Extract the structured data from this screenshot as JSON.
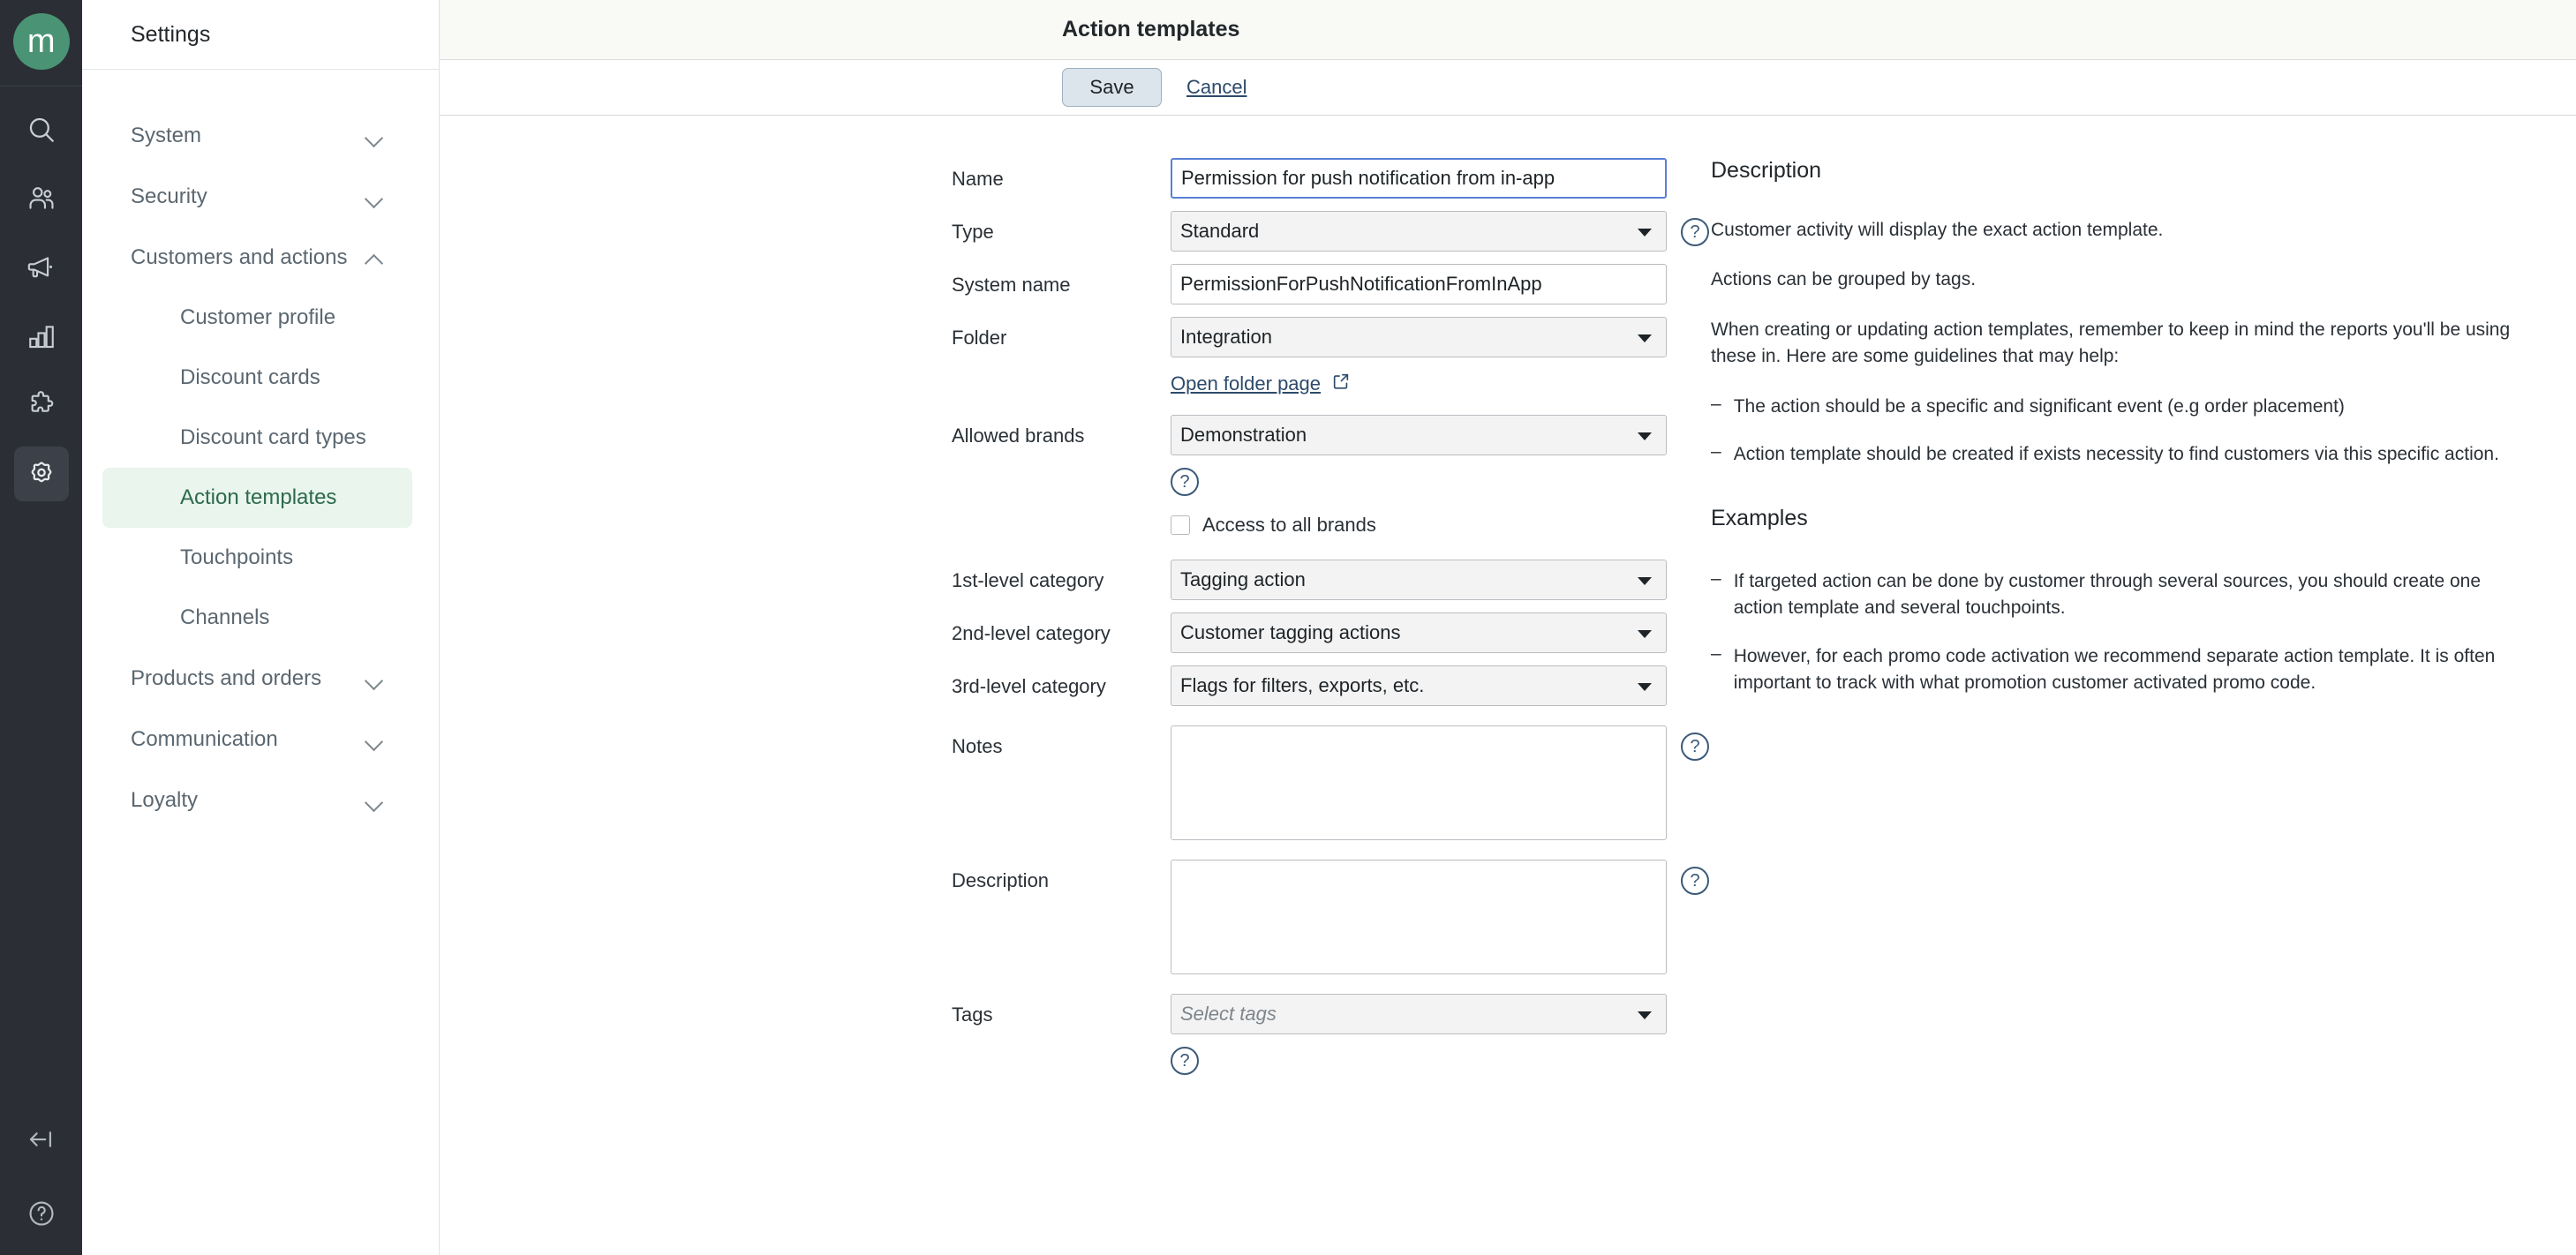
{
  "rail": {
    "logo_text": "m",
    "items": [
      {
        "name": "search-icon",
        "label": "Search",
        "active": false
      },
      {
        "name": "customers-icon",
        "label": "Customers",
        "active": false
      },
      {
        "name": "campaigns-megaphone-icon",
        "label": "Campaigns",
        "active": false
      },
      {
        "name": "analytics-bar-chart-icon",
        "label": "Analytics",
        "active": false
      },
      {
        "name": "integrations-puzzle-icon",
        "label": "Integrations",
        "active": false
      },
      {
        "name": "settings-gear-icon",
        "label": "Settings",
        "active": true
      }
    ],
    "bottom": [
      {
        "name": "collapse-sidebar-icon",
        "label": "Collapse"
      },
      {
        "name": "help-circle-icon",
        "label": "Help"
      }
    ]
  },
  "sidebar": {
    "title": "Settings",
    "groups": [
      {
        "label": "System",
        "expanded": false,
        "items": []
      },
      {
        "label": "Security",
        "expanded": false,
        "items": []
      },
      {
        "label": "Customers and actions",
        "expanded": true,
        "items": [
          {
            "label": "Customer profile",
            "active": false
          },
          {
            "label": "Discount cards",
            "active": false
          },
          {
            "label": "Discount card types",
            "active": false
          },
          {
            "label": "Action templates",
            "active": true
          },
          {
            "label": "Touchpoints",
            "active": false
          },
          {
            "label": "Channels",
            "active": false
          }
        ]
      },
      {
        "label": "Products and orders",
        "expanded": false,
        "items": []
      },
      {
        "label": "Communication",
        "expanded": false,
        "items": []
      },
      {
        "label": "Loyalty",
        "expanded": false,
        "items": []
      }
    ]
  },
  "page": {
    "title": "Action templates",
    "toolbar": {
      "save_label": "Save",
      "cancel_label": "Cancel"
    }
  },
  "form": {
    "name": {
      "label": "Name",
      "value": "Permission for push notification from in-app"
    },
    "type": {
      "label": "Type",
      "value": "Standard"
    },
    "system_name": {
      "label": "System name",
      "value": "PermissionForPushNotificationFromInApp"
    },
    "folder": {
      "label": "Folder",
      "value": "Integration"
    },
    "folder_link": {
      "label": "Open folder page"
    },
    "allowed_brands": {
      "label": "Allowed brands",
      "value": "Demonstration"
    },
    "access_all_brands": {
      "label": "Access to all brands",
      "checked": false
    },
    "cat1": {
      "label": "1st-level category",
      "value": "Tagging action"
    },
    "cat2": {
      "label": "2nd-level category",
      "value": "Customer tagging actions"
    },
    "cat3": {
      "label": "3rd-level category",
      "value": "Flags for filters, exports, etc."
    },
    "notes": {
      "label": "Notes",
      "value": ""
    },
    "description": {
      "label": "Description",
      "value": ""
    },
    "tags": {
      "label": "Tags",
      "placeholder": "Select tags",
      "value": ""
    },
    "help_glyph": "?"
  },
  "description_panel": {
    "heading": "Description",
    "paragraphs": [
      "Customer activity will display the exact action template.",
      "Actions can be grouped by tags.",
      "When creating or updating action templates, remember to keep in mind the reports you'll be using these in. Here are some guidelines that may help:"
    ],
    "bullets": [
      "The action should be a specific and significant event (e.g order placement)",
      "Action template should be created if exists necessity to find customers via this specific action."
    ],
    "examples_heading": "Examples",
    "examples_bullets": [
      "If targeted action can be done by customer through several sources, you should create one action template and several touchpoints.",
      "However, for each promo code activation we recommend separate action template. It is often important to track with what promotion customer activated promo code."
    ],
    "dash": "–"
  },
  "colors": {
    "rail_bg": "#2b2f35",
    "brand_green": "#4a9475",
    "active_nav_bg": "#e9f5ed",
    "active_nav_text": "#2d6a4a",
    "header_bg": "#f9faf5",
    "link_blue": "#2d4a6b",
    "focus_blue": "#5a7fd6",
    "save_bg": "#dce4ec"
  }
}
